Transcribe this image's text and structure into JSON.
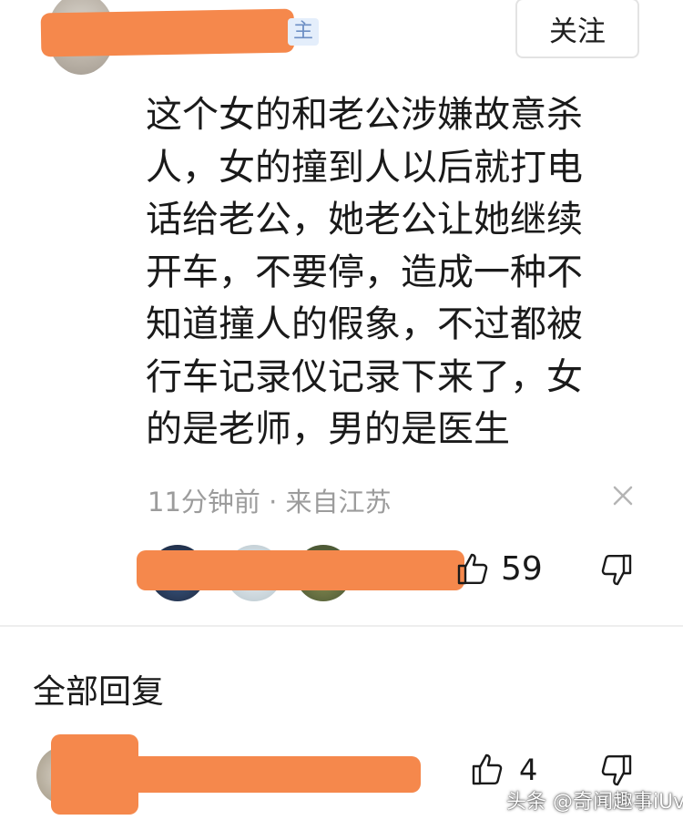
{
  "header": {
    "author_tag": "主",
    "follow_label": "关注"
  },
  "comment": {
    "lines": [
      "这个女的和老公涉嫌故意杀",
      "人，女的撞到人以后就打电",
      "话给老公，她老公让她继续",
      "开车，不要停，造成一种不",
      "知道撞人的假象，不过都被",
      "行车记录仪记录下来了，女",
      "的是老师，男的是医生"
    ],
    "meta": "11分钟前 · 来自江苏",
    "like_count": "59"
  },
  "replies_section": {
    "title": "全部回复"
  },
  "reply": {
    "like_count": "4"
  },
  "watermark": "头条 @奇闻趣事iUvI",
  "colors": {
    "redaction": "#f5884c",
    "meta_text": "#9c9c9c",
    "tag_bg": "#e4eefb",
    "tag_text": "#6d8fc4"
  },
  "icons": [
    "close-icon",
    "thumb-up-icon",
    "thumb-down-icon"
  ]
}
